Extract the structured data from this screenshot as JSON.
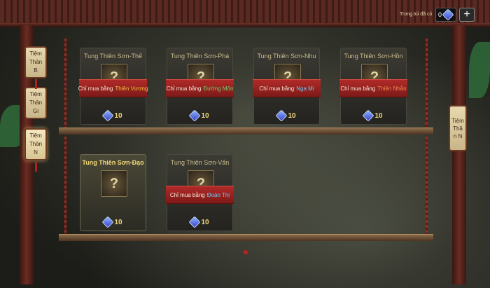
{
  "currency": {
    "label": "Trong túi đã có",
    "value": "0",
    "icon": "blue-gem-icon",
    "add_label": "+"
  },
  "store_tabs": [
    {
      "label": "Tiệm Thần B",
      "active": false
    },
    {
      "label": "Tiệm Thần Gi",
      "active": false
    },
    {
      "label": "Tiệm Thần N",
      "active": true
    }
  ],
  "right_tab": {
    "label": "Tiệm Thần N"
  },
  "items": [
    {
      "name": "Tung Thiên Sơn-Thế",
      "locked": true,
      "buy_prefix": "Chỉ mua bằng",
      "faction": "Thiên Vương",
      "faction_color": "#f0c040",
      "price": "10"
    },
    {
      "name": "Tung Thiên Sơn-Phá",
      "locked": true,
      "buy_prefix": "Chỉ mua bằng",
      "faction": "Đường Môn",
      "faction_color": "#6ad06a",
      "price": "10"
    },
    {
      "name": "Tung Thiên Sơn-Nhu",
      "locked": true,
      "buy_prefix": "Chỉ mua bằng",
      "faction": "Nga Mi",
      "faction_color": "#6ac8f0",
      "price": "10"
    },
    {
      "name": "Tung Thiên Sơn-Hồn",
      "locked": true,
      "buy_prefix": "Chỉ mua bằng",
      "faction": "Thiên Nhẫn",
      "faction_color": "#f08a50",
      "price": "10"
    },
    {
      "name": "Tung Thiên Sơn-Đạo",
      "locked": false,
      "icon_mark": "?",
      "price": "10"
    },
    {
      "name": "Tung Thiên Sơn-Vấn",
      "locked": true,
      "buy_prefix": "Chỉ mua bằng",
      "faction": "Đoàn Thị",
      "faction_color": "#6ac8f0",
      "price": "10"
    }
  ]
}
